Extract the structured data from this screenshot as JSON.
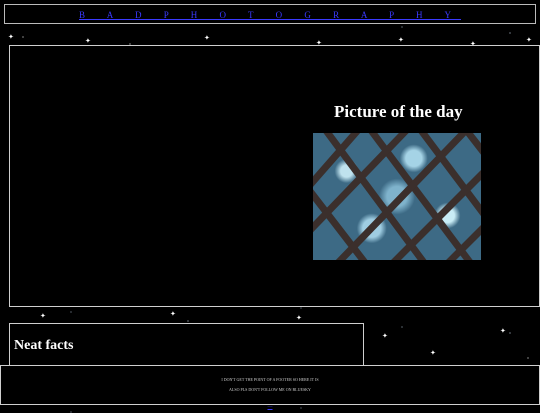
{
  "nav": {
    "label": "B A D   P H O T O G R A P H Y"
  },
  "picture_of_the_day": {
    "title": "Picture of the day",
    "image_icon": "trellis-photo"
  },
  "neat_facts": {
    "title": "Neat facts"
  },
  "footer": {
    "line1": "I DON'T GET THE POINT OF A FOOTER SO HERE IT IS",
    "line2": "ALSO PLS DON'T FOLLOW ME ON BLUESKY",
    "link_label": "—"
  }
}
